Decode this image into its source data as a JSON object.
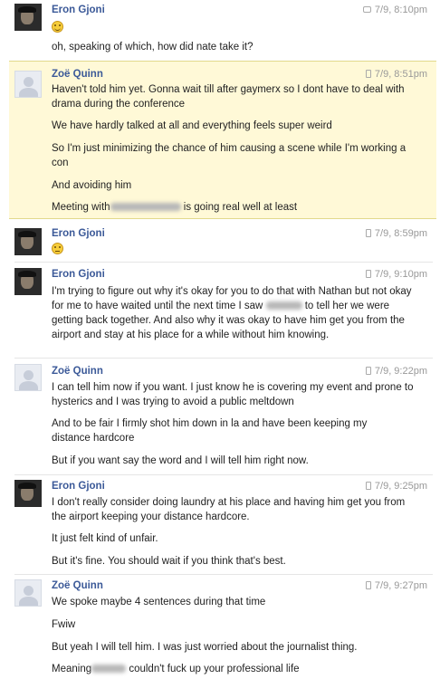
{
  "messages": [
    {
      "sender": "Eron Gjoni",
      "time": "7/9, 8:10pm",
      "device": "chat",
      "emoji": "grin",
      "lines": [
        "oh, speaking of which, how did nate take it?"
      ]
    },
    {
      "sender": "Zoë Quinn",
      "time": "7/9, 8:51pm",
      "device": "mobile",
      "highlighted": true,
      "lines": [
        "Haven't told him yet. Gonna wait till after gaymerx so I dont have to deal with drama during the conference",
        "We have hardly talked at all and everything feels super weird",
        "So I'm just minimizing the chance of him causing a scene while I'm working a con",
        "And avoiding him",
        {
          "before": "Meeting with",
          "after": "is going real well at least"
        }
      ]
    },
    {
      "sender": "Eron Gjoni",
      "time": "7/9, 8:59pm",
      "device": "mobile",
      "emoji": "flat"
    },
    {
      "sender": "Eron Gjoni",
      "time": "7/9, 9:10pm",
      "device": "mobile",
      "lines": [
        {
          "before": "I'm trying to figure out why it's okay for you to do that with Nathan but not okay for me to have waited until the next time I saw",
          "after": "to tell her we were getting back together. And also why it was okay to have him get you from the airport and stay at his place for a while without him knowing."
        }
      ]
    },
    {
      "sender": "Zoë Quinn",
      "time": "7/9, 9:22pm",
      "device": "mobile",
      "lines": [
        "I can tell him now if you want. I just know he is covering my event and prone to hysterics and I was trying to avoid a public meltdown",
        "And to be fair I firmly shot him down in la and have been keeping my distance hardcore",
        "But if you want say the word and I will tell him right now."
      ]
    },
    {
      "sender": "Eron Gjoni",
      "time": "7/9, 9:25pm",
      "device": "mobile",
      "lines": [
        "I don't really consider doing laundry at his place and having him get you from the airport keeping your distance hardcore.",
        "It just felt kind of unfair.",
        "But it's fine. You should wait if you think that's best."
      ]
    },
    {
      "sender": "Zoë Quinn",
      "time": "7/9, 9:27pm",
      "device": "mobile",
      "lines": [
        "We spoke maybe 4 sentences during that time",
        "Fwiw",
        "But yeah I will tell him. I was just worried about the journalist thing.",
        {
          "before": "Meaning",
          "after": "couldn't fuck up your professional life"
        }
      ]
    }
  ]
}
